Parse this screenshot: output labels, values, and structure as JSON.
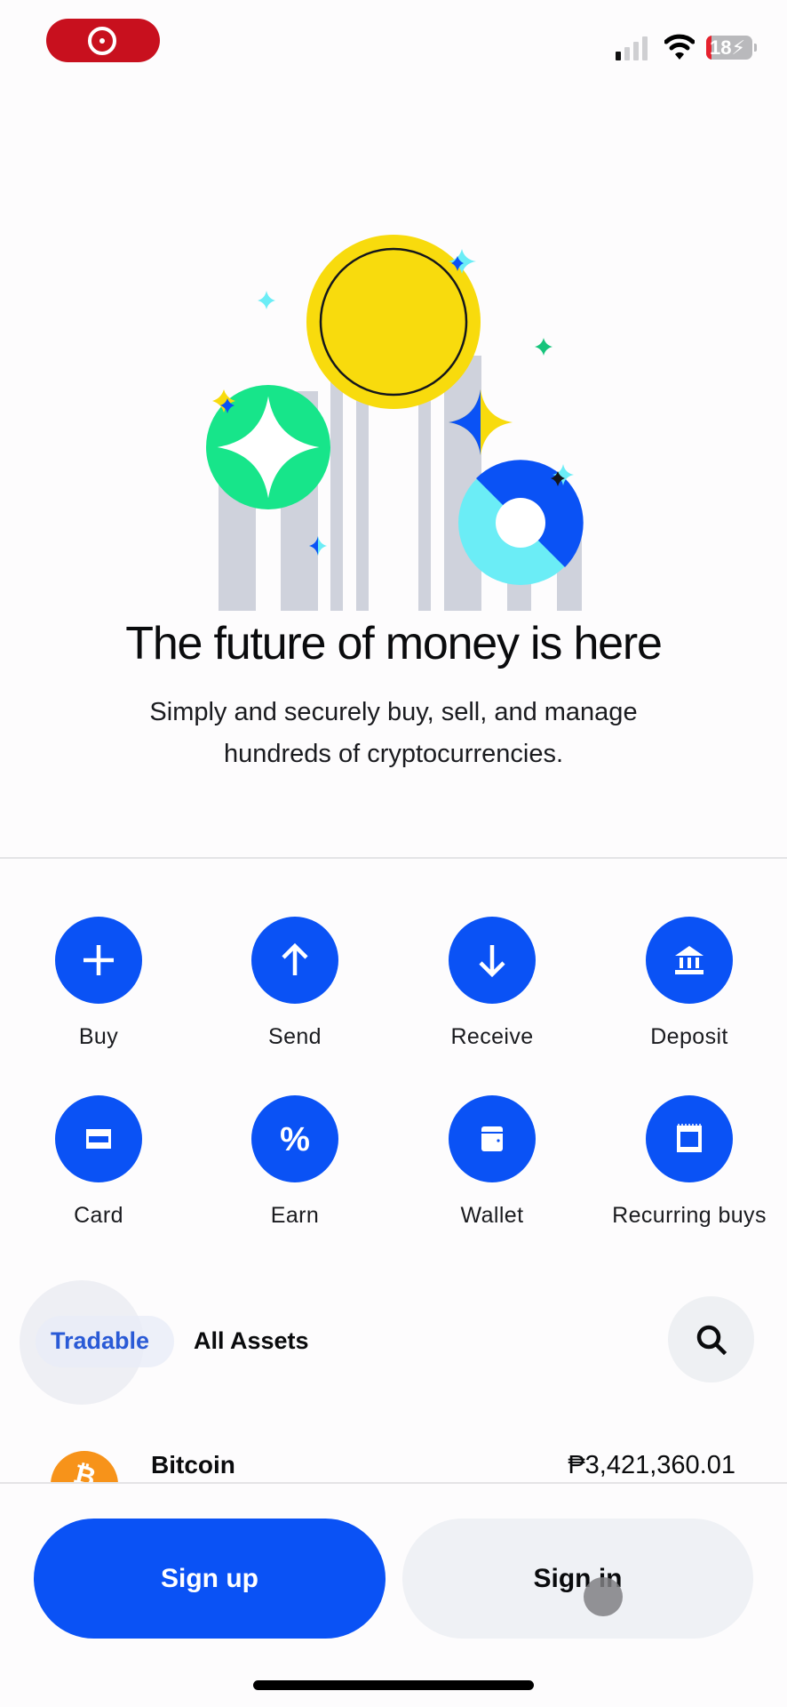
{
  "status_bar": {
    "recording_indicator": "screen-recording-icon",
    "battery_level": "18",
    "icons": [
      "cellular-signal-icon",
      "wifi-icon",
      "battery-charging-icon"
    ]
  },
  "hero": {
    "illustration": "crypto-coins-illustration",
    "title": "The future of money is here",
    "subtitle": "Simply and securely buy, sell, and manage hundreds of cryptocurrencies."
  },
  "actions": [
    {
      "label": "Buy",
      "icon": "plus-icon"
    },
    {
      "label": "Send",
      "icon": "arrow-up-icon"
    },
    {
      "label": "Receive",
      "icon": "arrow-down-icon"
    },
    {
      "label": "Deposit",
      "icon": "bank-icon"
    },
    {
      "label": "Card",
      "icon": "card-icon"
    },
    {
      "label": "Earn",
      "icon": "percent-icon"
    },
    {
      "label": "Wallet",
      "icon": "wallet-icon"
    },
    {
      "label": "Recurring buys",
      "icon": "calendar-icon"
    }
  ],
  "asset_tabs": {
    "tabs": [
      "Tradable",
      "All Assets"
    ],
    "active": "Tradable",
    "search_icon": "search-icon"
  },
  "assets": [
    {
      "name": "Bitcoin",
      "symbol_glyph": "₿",
      "price": "₱3,421,360.01"
    }
  ],
  "footer": {
    "signup_label": "Sign up",
    "signin_label": "Sign in"
  },
  "colors": {
    "brand_blue": "#0a52f5",
    "active_tab": "#2a5ad6",
    "bitcoin_orange": "#f7931a",
    "recording_red": "#c8101e"
  }
}
